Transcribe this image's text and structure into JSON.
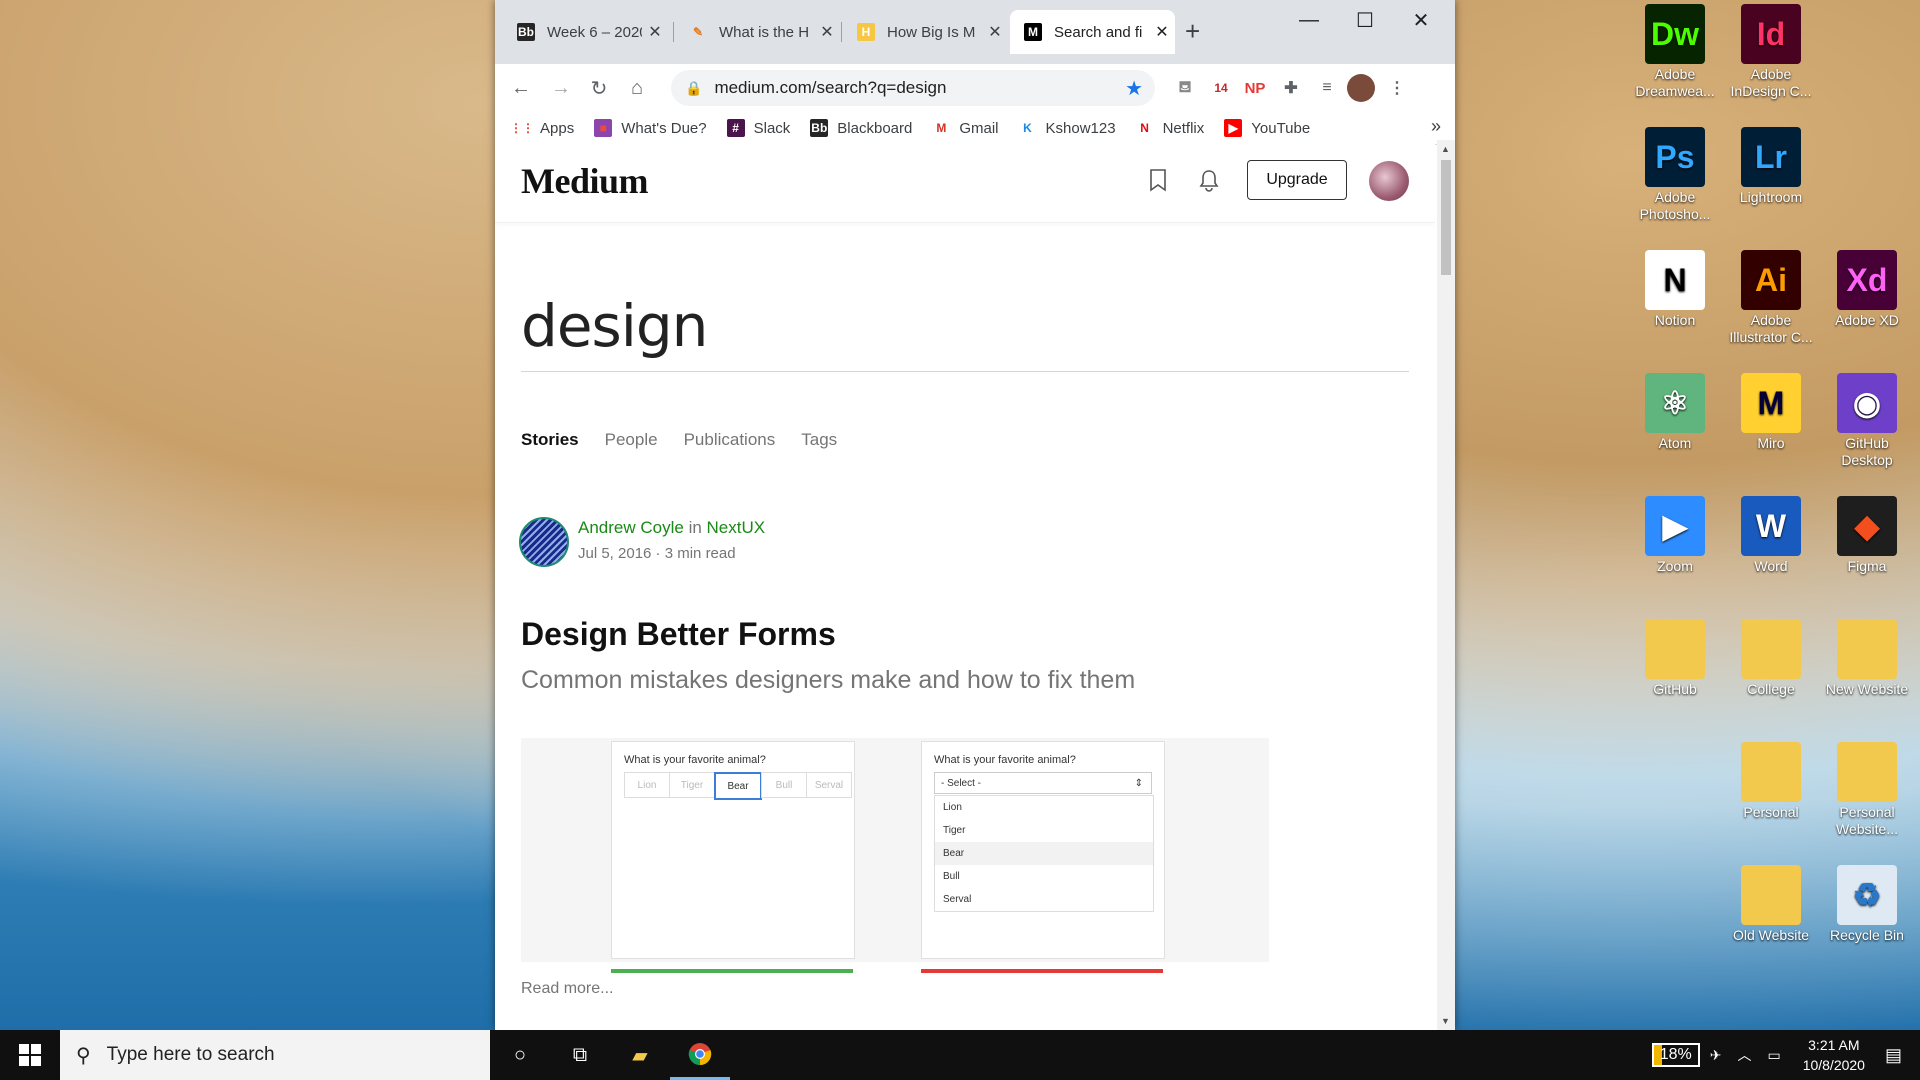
{
  "desktop": {
    "icons": [
      {
        "label": "Adobe Dreamwea...",
        "glyph": "Dw",
        "bg": "#072401",
        "fg": "#4bff00"
      },
      {
        "label": "Adobe InDesign C...",
        "glyph": "Id",
        "bg": "#49021f",
        "fg": "#ff3366"
      },
      {
        "label": "",
        "glyph": "",
        "bg": "transparent",
        "fg": "#fff"
      },
      {
        "label": "Adobe Photosho...",
        "glyph": "Ps",
        "bg": "#001e36",
        "fg": "#31a8ff"
      },
      {
        "label": "Lightroom",
        "glyph": "Lr",
        "bg": "#001e36",
        "fg": "#31a8ff"
      },
      {
        "label": "",
        "glyph": "",
        "bg": "transparent",
        "fg": "#fff"
      },
      {
        "label": "Notion",
        "glyph": "N",
        "bg": "#ffffff",
        "fg": "#000000"
      },
      {
        "label": "Adobe Illustrator C...",
        "glyph": "Ai",
        "bg": "#330000",
        "fg": "#ff9a00"
      },
      {
        "label": "Adobe XD",
        "glyph": "Xd",
        "bg": "#470137",
        "fg": "#ff61f6"
      },
      {
        "label": "Atom",
        "glyph": "⚛",
        "bg": "#5fb57d",
        "fg": "#ffffff"
      },
      {
        "label": "Miro",
        "glyph": "M",
        "bg": "#ffd02f",
        "fg": "#050038"
      },
      {
        "label": "GitHub Desktop",
        "glyph": "◉",
        "bg": "#6e40c9",
        "fg": "#ffffff"
      },
      {
        "label": "Zoom",
        "glyph": "▶",
        "bg": "#2d8cff",
        "fg": "#ffffff"
      },
      {
        "label": "Word",
        "glyph": "W",
        "bg": "#185abd",
        "fg": "#ffffff"
      },
      {
        "label": "Figma",
        "glyph": "◆",
        "bg": "#1e1e1e",
        "fg": "#f24e1e"
      },
      {
        "label": "GitHub",
        "glyph": "",
        "bg": "#f2c94c",
        "fg": "#fff"
      },
      {
        "label": "College",
        "glyph": "",
        "bg": "#f2c94c",
        "fg": "#fff"
      },
      {
        "label": "New Website",
        "glyph": "",
        "bg": "#f2c94c",
        "fg": "#fff"
      },
      {
        "label": "",
        "glyph": "",
        "bg": "transparent",
        "fg": "#fff"
      },
      {
        "label": "Personal",
        "glyph": "",
        "bg": "#f2c94c",
        "fg": "#fff"
      },
      {
        "label": "Personal Website...",
        "glyph": "",
        "bg": "#f2c94c",
        "fg": "#fff"
      },
      {
        "label": "",
        "glyph": "",
        "bg": "transparent",
        "fg": "#fff"
      },
      {
        "label": "Old Website",
        "glyph": "",
        "bg": "#f2c94c",
        "fg": "#fff"
      },
      {
        "label": "Recycle Bin",
        "glyph": "♻",
        "bg": "#dfe9f3",
        "fg": "#2a78c9"
      }
    ]
  },
  "browser": {
    "tabs": [
      {
        "title": "Week 6 – 2020",
        "favicon": "Bb",
        "fav_bg": "#262626",
        "fav_fg": "#fff"
      },
      {
        "title": "What is the H",
        "favicon": "✎",
        "fav_bg": "#fff",
        "fav_fg": "#e67e22"
      },
      {
        "title": "How Big Is M",
        "favicon": "H",
        "fav_bg": "#f6c744",
        "fav_fg": "#fff"
      },
      {
        "title": "Search and fi",
        "favicon": "M",
        "fav_bg": "#000",
        "fav_fg": "#fff"
      }
    ],
    "new_tab": "+",
    "window_controls": {
      "minimize": "—",
      "maximize": "☐",
      "close": "✕"
    },
    "url": "medium.com/search?q=design",
    "ext_badge": "14",
    "ext_np": "NP",
    "bookmarks": [
      {
        "label": "Apps",
        "icon": "⋮⋮",
        "bg": "#fff",
        "fg": "#e34133"
      },
      {
        "label": "What's Due?",
        "icon": "■",
        "bg": "#8e44ad",
        "fg": "#e74c3c"
      },
      {
        "label": "Slack",
        "icon": "#",
        "bg": "#4a154b",
        "fg": "#fff"
      },
      {
        "label": "Blackboard",
        "icon": "Bb",
        "bg": "#262626",
        "fg": "#fff"
      },
      {
        "label": "Gmail",
        "icon": "M",
        "bg": "#fff",
        "fg": "#d93025"
      },
      {
        "label": "Kshow123",
        "icon": "K",
        "bg": "#fff",
        "fg": "#1e88e5"
      },
      {
        "label": "Netflix",
        "icon": "N",
        "bg": "#fff",
        "fg": "#e50914"
      },
      {
        "label": "YouTube",
        "icon": "▶",
        "bg": "#ff0000",
        "fg": "#fff"
      }
    ],
    "bookmarks_more": "»"
  },
  "medium": {
    "logo": "Medium",
    "upgrade": "Upgrade",
    "query": "design",
    "tabs": [
      "Stories",
      "People",
      "Publications",
      "Tags"
    ],
    "story": {
      "author": "Andrew Coyle",
      "in_word": "in",
      "publication": "NextUX",
      "meta": "Jul 5, 2016 · 3 min read",
      "title": "Design Better Forms",
      "subtitle": "Common mistakes designers make and how to fix them",
      "read_more": "Read more..."
    },
    "preview": {
      "question": "What is your favorite animal?",
      "options": [
        "Lion",
        "Tiger",
        "Bear",
        "Bull",
        "Serval"
      ],
      "select_placeholder": "- Select -",
      "good_color": "#4caf50",
      "bad_color": "#e53935"
    }
  },
  "taskbar": {
    "search_placeholder": "Type here to search",
    "battery": "18%",
    "time": "3:21 AM",
    "date": "10/8/2020"
  }
}
